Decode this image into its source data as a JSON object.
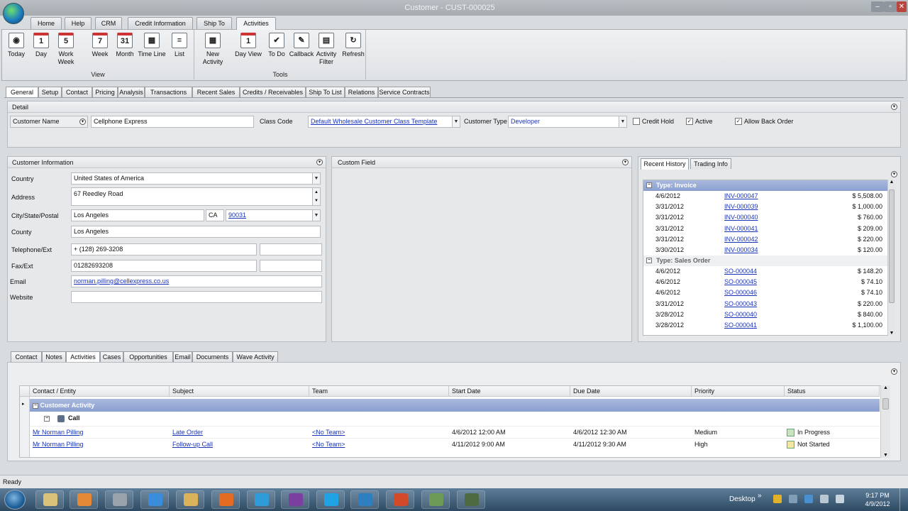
{
  "window": {
    "title": "Customer - CUST-000025",
    "min": "–",
    "max": "▫",
    "close": "✕"
  },
  "ribbon_tabs": [
    "Home",
    "Help",
    "CRM",
    "Credit Information",
    "Ship To",
    "Activities"
  ],
  "ribbon": {
    "view_group": "View",
    "tools_group": "Tools",
    "view_buttons": [
      {
        "label": "Today",
        "icon": "◉"
      },
      {
        "label": "Day",
        "icon": "1"
      },
      {
        "label": "Work Week",
        "icon": "5"
      },
      {
        "label": "Week",
        "icon": "7"
      },
      {
        "label": "Month",
        "icon": "31"
      },
      {
        "label": "Time Line",
        "icon": "▦"
      },
      {
        "label": "List",
        "icon": "≡"
      }
    ],
    "tool_buttons": [
      {
        "label": "New Activity",
        "icon": "▦"
      },
      {
        "label": "Day View",
        "icon": "1"
      },
      {
        "label": "To Do",
        "icon": "✔"
      },
      {
        "label": "Callback",
        "icon": "✎"
      },
      {
        "label": "Activity Filter",
        "icon": "▤"
      },
      {
        "label": "Refresh",
        "icon": "↻"
      }
    ]
  },
  "main_tabs": [
    "General",
    "Setup",
    "Contact",
    "Pricing",
    "Analysis",
    "Transactions",
    "Recent Sales",
    "Credits / Receivables",
    "Ship To List",
    "Relations",
    "Service Contracts"
  ],
  "detail": {
    "title": "Detail",
    "customer_name_label": "Customer Name",
    "customer_name": "Cellphone Express",
    "class_code_label": "Class Code",
    "class_code": "Default Wholesale Customer Class Template",
    "customer_type_label": "Customer Type",
    "customer_type": "Developer",
    "credit_hold": "Credit Hold",
    "active": "Active",
    "allow_back_order": "Allow Back Order"
  },
  "customer_info": {
    "title": "Customer Information",
    "country_label": "Country",
    "country": "United States of America",
    "address_label": "Address",
    "address": "67 Reedley Road",
    "csp_label": "City/State/Postal",
    "city": "Los Angeles",
    "state": "CA",
    "postal": "90031",
    "county_label": "County",
    "county": "Los Angeles",
    "tel_label": "Telephone/Ext",
    "tel": "+ (128) 269-3208",
    "fax_label": "Fax/Ext",
    "fax": "01282693208",
    "email_label": "Email",
    "email": "norman.pilling@cellexpress.co.us",
    "website_label": "Website"
  },
  "custom_field": {
    "title": "Custom Field"
  },
  "history_tabs": [
    "Recent History",
    "Trading Info"
  ],
  "history": {
    "invoice_group": "Type: Invoice",
    "invoices": [
      {
        "date": "4/6/2012",
        "doc": "INV-000047",
        "amount": "$ 5,508.00"
      },
      {
        "date": "3/31/2012",
        "doc": "INV-000039",
        "amount": "$ 1,000.00"
      },
      {
        "date": "3/31/2012",
        "doc": "INV-000040",
        "amount": "$ 760.00"
      },
      {
        "date": "3/31/2012",
        "doc": "INV-000041",
        "amount": "$ 209.00"
      },
      {
        "date": "3/31/2012",
        "doc": "INV-000042",
        "amount": "$ 220.00"
      },
      {
        "date": "3/30/2012",
        "doc": "INV-000034",
        "amount": "$ 120.00"
      }
    ],
    "sales_group": "Type: Sales Order",
    "sales": [
      {
        "date": "4/6/2012",
        "doc": "SO-000044",
        "amount": "$ 148.20"
      },
      {
        "date": "4/6/2012",
        "doc": "SO-000045",
        "amount": "$ 74.10"
      },
      {
        "date": "4/6/2012",
        "doc": "SO-000046",
        "amount": "$ 74.10"
      },
      {
        "date": "3/31/2012",
        "doc": "SO-000043",
        "amount": "$ 220.00"
      },
      {
        "date": "3/28/2012",
        "doc": "SO-000040",
        "amount": "$ 840.00"
      },
      {
        "date": "3/28/2012",
        "doc": "SO-000041",
        "amount": "$ 1,100.00"
      }
    ]
  },
  "bottom_tabs": [
    "Contact",
    "Notes",
    "Activities",
    "Cases",
    "Opportunities",
    "Email",
    "Documents",
    "Wave Activity"
  ],
  "activities": {
    "columns": [
      "Contact / Entity",
      "Subject",
      "Team",
      "Start Date",
      "Due Date",
      "Priority",
      "Status"
    ],
    "group": "Customer Activity",
    "subgroup": "Call",
    "rows": [
      {
        "contact": "Mr Norman Pilling",
        "subject": "Late Order",
        "team": "<No Team>",
        "start": "4/6/2012 12:00 AM",
        "due": "4/6/2012 12:30 AM",
        "priority": "Medium",
        "status": "In Progress"
      },
      {
        "contact": "Mr Norman Pilling",
        "subject": "Follow-up Call",
        "team": "<No Team>",
        "start": "4/11/2012 9:00 AM",
        "due": "4/11/2012 9:30 AM",
        "priority": "High",
        "status": "Not Started"
      }
    ]
  },
  "status_bar": {
    "text": "Ready"
  },
  "taskbar": {
    "desktop": "Desktop",
    "time": "9:17 PM",
    "date": "4/9/2012"
  },
  "colors": {
    "accent": "#8aa0d0",
    "link": "#1a34b8"
  }
}
